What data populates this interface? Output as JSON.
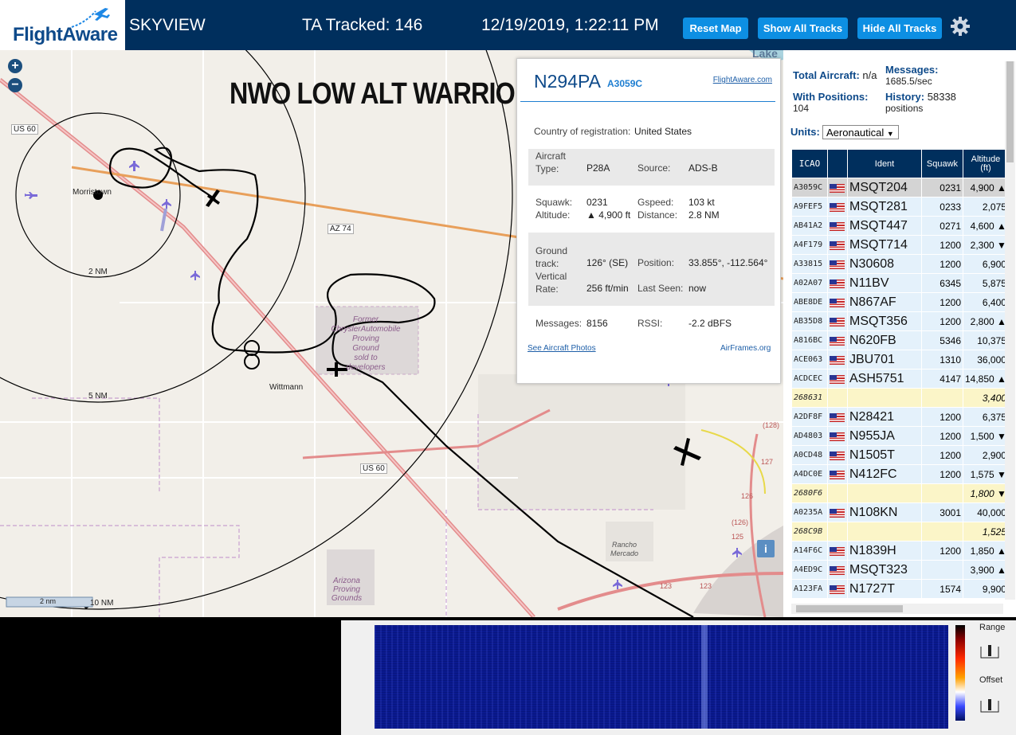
{
  "header": {
    "brand": "FlightAware",
    "app_name": "SKYVIEW",
    "tracked_label": "TA Tracked: 146",
    "datetime": "12/19/2019, 1:22:11 PM",
    "buttons": {
      "reset_map": "Reset Map",
      "show_all": "Show All Tracks",
      "hide_all": "Hide All Tracks"
    },
    "settings_icon": "gear-icon"
  },
  "map": {
    "zoom_in": "+",
    "zoom_out": "−",
    "overlay_title": "NWO LOW ALT WARRIOR",
    "labels": {
      "us60_a": "US 60",
      "us60_b": "US 60",
      "az74": "AZ 74",
      "morristown": "Morristown",
      "wittmann": "Wittmann",
      "ring_2nm": "2 NM",
      "ring_5nm": "5 NM",
      "ring_10nm": "10 NM",
      "scale": "2 nm",
      "lake": "Lake",
      "former": "Former\nChryslerAutomobile\nProving\nGround\nsold to\ndevelopers",
      "arizona": "Arizona\nProving\nGrounds",
      "rancho": "Rancho\nMercado",
      "rt126a": "126",
      "rt126b": "(126)",
      "rt123a": "123",
      "rt123b": "123",
      "rt127": "127",
      "rt128": "(128)",
      "rt125": "125"
    },
    "info": "i",
    "colors": {
      "land": "#f2efe9",
      "track": "#000000",
      "range_ring": "#000000",
      "highway": "#e89f5a",
      "us60": "#e38c8c"
    }
  },
  "popup": {
    "flight": "N294PA",
    "hex": "A3059C",
    "fa_link": "FlightAware.com",
    "country_label": "Country of registration:",
    "country_value": "United States",
    "aircraft_type_label": "Aircraft\nType:",
    "aircraft_type_value": "P28A",
    "source_label": "Source:",
    "source_value": "ADS-B",
    "squawk_label": "Squawk:",
    "squawk_value": "0231",
    "gspeed_label": "Gspeed:",
    "gspeed_value": "103 kt",
    "altitude_label": "Altitude:",
    "altitude_value": "▲ 4,900 ft",
    "distance_label": "Distance:",
    "distance_value": "2.8 NM",
    "track_label": "Ground\ntrack:",
    "track_value": "126° (SE)",
    "position_label": "Position:",
    "position_value": "33.855°, -112.564°",
    "vrate_label": "Vertical\nRate:",
    "vrate_value": "256 ft/min",
    "lastseen_label": "Last Seen:",
    "lastseen_value": "now",
    "messages_label": "Messages:",
    "messages_value": "8156",
    "rssi_label": "RSSI:",
    "rssi_value": "-2.2 dBFS",
    "photos_link": "See Aircraft Photos",
    "airframes_link": "AirFrames.org"
  },
  "sidebar": {
    "total_label": "Total Aircraft:",
    "total_value": "n/a",
    "messages_label": "Messages:",
    "messages_value": "1685.5/sec",
    "positions_label": "With Positions:",
    "positions_value": "104",
    "history_label": "History:",
    "history_value": "58338",
    "history_unit": "positions",
    "units_label": "Units:",
    "units_value": "Aeronautical",
    "columns": {
      "icao": "ICAO",
      "ident": "Ident",
      "squawk": "Squawk",
      "altitude": "Altitude\n(ft)"
    },
    "rows": [
      {
        "icao": "A3059C",
        "flag": "United States",
        "ident": "MSQT204",
        "squawk": "0231",
        "altitude": "4,900 ▲",
        "style": "sel"
      },
      {
        "icao": "A9FEF5",
        "flag": "United States",
        "ident": "MSQT281",
        "squawk": "0233",
        "altitude": "2,075",
        "style": "r"
      },
      {
        "icao": "AB41A2",
        "flag": "United States",
        "ident": "MSQT447",
        "squawk": "0271",
        "altitude": "4,600 ▲",
        "style": "r"
      },
      {
        "icao": "A4F179",
        "flag": "United States",
        "ident": "MSQT714",
        "squawk": "1200",
        "altitude": "2,300 ▼",
        "style": "r"
      },
      {
        "icao": "A33815",
        "flag": "United States",
        "ident": "N30608",
        "squawk": "1200",
        "altitude": "6,900",
        "style": "r"
      },
      {
        "icao": "A02A07",
        "flag": "United States",
        "ident": "N11BV",
        "squawk": "6345",
        "altitude": "5,875",
        "style": "r"
      },
      {
        "icao": "ABE8DE",
        "flag": "United States",
        "ident": "N867AF",
        "squawk": "1200",
        "altitude": "6,400",
        "style": "r"
      },
      {
        "icao": "AB35D8",
        "flag": "United States",
        "ident": "MSQT356",
        "squawk": "1200",
        "altitude": "2,800 ▲",
        "style": "r"
      },
      {
        "icao": "A816BC",
        "flag": "United States",
        "ident": "N620FB",
        "squawk": "5346",
        "altitude": "10,375",
        "style": "r"
      },
      {
        "icao": "ACE063",
        "flag": "United States",
        "ident": "JBU701",
        "squawk": "1310",
        "altitude": "36,000",
        "style": "r"
      },
      {
        "icao": "ACDCEC",
        "flag": "United States",
        "ident": "ASH5751",
        "squawk": "4147",
        "altitude": "14,850 ▲",
        "style": "r"
      },
      {
        "icao": "268631",
        "flag": "",
        "ident": "",
        "squawk": "",
        "altitude": "3,400",
        "style": "y"
      },
      {
        "icao": "A2DF8F",
        "flag": "United States",
        "ident": "N28421",
        "squawk": "1200",
        "altitude": "6,375",
        "style": "r"
      },
      {
        "icao": "AD4803",
        "flag": "United States",
        "ident": "N955JA",
        "squawk": "1200",
        "altitude": "1,500 ▼",
        "style": "r"
      },
      {
        "icao": "A0CD48",
        "flag": "United States",
        "ident": "N1505T",
        "squawk": "1200",
        "altitude": "2,900",
        "style": "r"
      },
      {
        "icao": "A4DC0E",
        "flag": "United States",
        "ident": "N412FC",
        "squawk": "1200",
        "altitude": "1,575 ▼",
        "style": "r"
      },
      {
        "icao": "2680F6",
        "flag": "",
        "ident": "",
        "squawk": "",
        "altitude": "1,800 ▼",
        "style": "y"
      },
      {
        "icao": "A0235A",
        "flag": "United States",
        "ident": "N108KN",
        "squawk": "3001",
        "altitude": "40,000",
        "style": "r"
      },
      {
        "icao": "268C9B",
        "flag": "",
        "ident": "",
        "squawk": "",
        "altitude": "1,525",
        "style": "y"
      },
      {
        "icao": "A14F6C",
        "flag": "United States",
        "ident": "N1839H",
        "squawk": "1200",
        "altitude": "1,850 ▲",
        "style": "r"
      },
      {
        "icao": "A4ED9C",
        "flag": "United States",
        "ident": "MSQT323",
        "squawk": "",
        "altitude": "3,900 ▲",
        "style": "r"
      },
      {
        "icao": "A123FA",
        "flag": "United States",
        "ident": "N1727T",
        "squawk": "1574",
        "altitude": "9,900",
        "style": "r"
      }
    ]
  },
  "waterfall": {
    "range_label": "Range",
    "offset_label": "Offset"
  }
}
